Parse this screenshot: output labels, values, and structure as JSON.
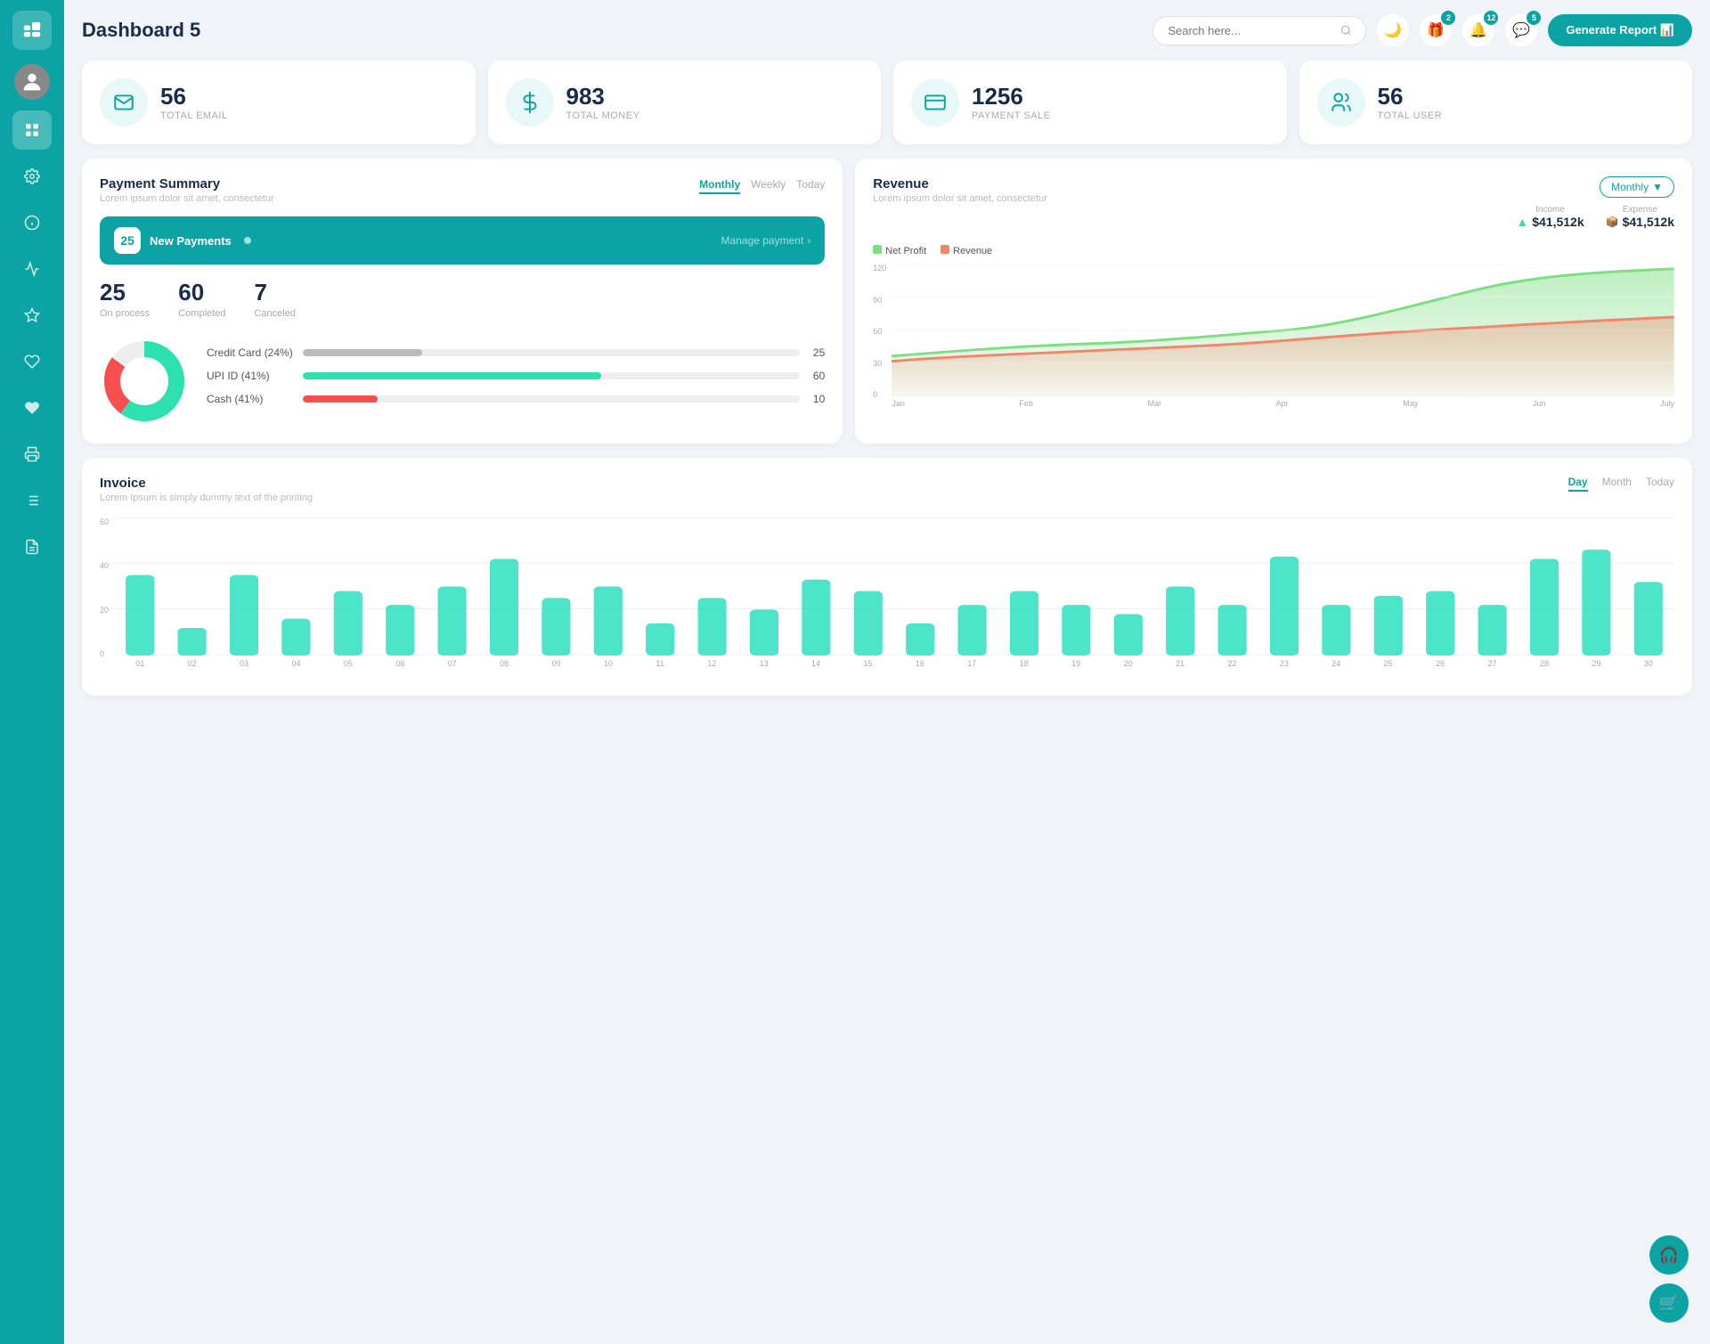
{
  "app": {
    "title": "Dashboard 5",
    "generate_report_label": "Generate Report"
  },
  "search": {
    "placeholder": "Search here..."
  },
  "header_icons": {
    "badges": {
      "gift": 2,
      "bell": 12,
      "chat": 5
    }
  },
  "stats": [
    {
      "id": "email",
      "number": "56",
      "label": "TOTAL EMAIL",
      "icon": "email-icon"
    },
    {
      "id": "money",
      "number": "983",
      "label": "TOTAL MONEY",
      "icon": "money-icon"
    },
    {
      "id": "payment",
      "number": "1256",
      "label": "PAYMENT SALE",
      "icon": "payment-icon"
    },
    {
      "id": "user",
      "number": "56",
      "label": "TOTAL USER",
      "icon": "user-icon"
    }
  ],
  "payment_summary": {
    "title": "Payment Summary",
    "subtitle": "Lorem ipsum dolor sit amet, consectetur",
    "tabs": [
      "Monthly",
      "Weekly",
      "Today"
    ],
    "active_tab": "Monthly",
    "new_payments": {
      "count": "25",
      "label": "New Payments",
      "manage_label": "Manage payment"
    },
    "stats": [
      {
        "number": "25",
        "label": "On process"
      },
      {
        "number": "60",
        "label": "Completed"
      },
      {
        "number": "7",
        "label": "Canceled"
      }
    ],
    "bars": [
      {
        "label": "Credit Card (24%)",
        "percent": 24,
        "color": "#bbb",
        "value": "25"
      },
      {
        "label": "UPI ID (41%)",
        "percent": 60,
        "color": "#2de0b0",
        "value": "60"
      },
      {
        "label": "Cash (41%)",
        "percent": 15,
        "color": "#f94e4e",
        "value": "10"
      }
    ],
    "donut": {
      "segments": [
        {
          "percent": 60,
          "color": "#2de0b0"
        },
        {
          "percent": 25,
          "color": "#f94e4e"
        },
        {
          "percent": 15,
          "color": "#eee"
        }
      ]
    }
  },
  "revenue": {
    "title": "Revenue",
    "subtitle": "Lorem ipsum dolor sit amet, consectetur",
    "dropdown_label": "Monthly",
    "income": {
      "label": "Income",
      "amount": "$41,512k"
    },
    "expense": {
      "label": "Expense",
      "amount": "$41,512k"
    },
    "legend": [
      {
        "label": "Net Profit",
        "color": "#7dde82"
      },
      {
        "label": "Revenue",
        "color": "#f4856a"
      }
    ],
    "x_labels": [
      "Jan",
      "Feb",
      "Mar",
      "Apr",
      "May",
      "Jun",
      "July"
    ],
    "y_labels": [
      "0",
      "30",
      "60",
      "90",
      "120"
    ]
  },
  "invoice": {
    "title": "Invoice",
    "subtitle": "Lorem Ipsum is simply dummy text of the printing",
    "tabs": [
      "Day",
      "Month",
      "Today"
    ],
    "active_tab": "Day",
    "y_labels": [
      "0",
      "20",
      "40",
      "60"
    ],
    "x_labels": [
      "01",
      "02",
      "03",
      "04",
      "05",
      "06",
      "07",
      "08",
      "09",
      "10",
      "11",
      "12",
      "13",
      "14",
      "15",
      "16",
      "17",
      "18",
      "19",
      "20",
      "21",
      "22",
      "23",
      "24",
      "25",
      "26",
      "27",
      "28",
      "29",
      "30"
    ],
    "bars": [
      35,
      12,
      35,
      16,
      28,
      22,
      30,
      42,
      25,
      30,
      14,
      25,
      20,
      33,
      28,
      14,
      22,
      28,
      22,
      18,
      30,
      22,
      43,
      22,
      26,
      28,
      22,
      42,
      46,
      32
    ]
  },
  "sidebar": {
    "icons": [
      "wallet",
      "dashboard",
      "settings",
      "info",
      "chart",
      "star",
      "heart",
      "heart2",
      "print",
      "list",
      "document"
    ]
  }
}
